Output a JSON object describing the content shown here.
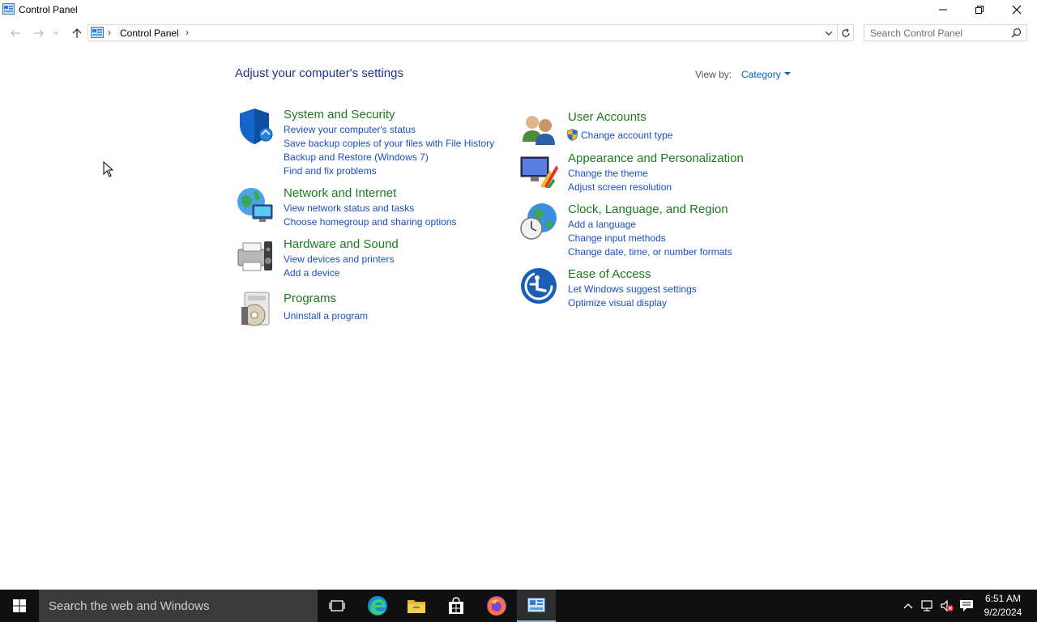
{
  "window": {
    "title": "Control Panel"
  },
  "address_bar": {
    "path": "Control Panel",
    "separator": "›"
  },
  "search": {
    "placeholder": "Search Control Panel"
  },
  "main": {
    "heading": "Adjust your computer's settings",
    "view_by_label": "View by:",
    "view_by_value": "Category",
    "left_categories": [
      {
        "title": "System and Security",
        "icon": "shield-icon",
        "links": [
          "Review your computer's status",
          "Save backup copies of your files with File History",
          "Backup and Restore (Windows 7)",
          "Find and fix problems"
        ]
      },
      {
        "title": "Network and Internet",
        "icon": "network-globe-icon",
        "links": [
          "View network status and tasks",
          "Choose homegroup and sharing options"
        ]
      },
      {
        "title": "Hardware and Sound",
        "icon": "printer-speaker-icon",
        "links": [
          "View devices and printers",
          "Add a device"
        ]
      },
      {
        "title": "Programs",
        "icon": "programs-disc-icon",
        "links": [
          "Uninstall a program"
        ]
      }
    ],
    "right_categories": [
      {
        "title": "User Accounts",
        "icon": "users-icon",
        "links": [
          "Change account type"
        ]
      },
      {
        "title": "Appearance and Personalization",
        "icon": "monitor-paint-icon",
        "links": [
          "Change the theme",
          "Adjust screen resolution"
        ]
      },
      {
        "title": "Clock, Language, and Region",
        "icon": "clock-globe-icon",
        "links": [
          "Add a language",
          "Change input methods",
          "Change date, time, or number formats"
        ]
      },
      {
        "title": "Ease of Access",
        "icon": "ease-of-access-icon",
        "links": [
          "Let Windows suggest settings",
          "Optimize visual display"
        ]
      }
    ]
  },
  "taskbar": {
    "search_placeholder": "Search the web and Windows",
    "time": "6:51 AM",
    "date": "9/2/2024"
  },
  "colors": {
    "category_title": "#1e7a1e",
    "link": "#1a4fc4",
    "heading": "#1e3287",
    "taskbar_bg": "#101010"
  }
}
